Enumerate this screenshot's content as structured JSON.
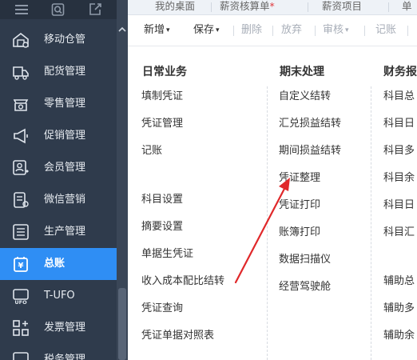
{
  "sidebar": {
    "top_icons": [
      "menu-icon",
      "search-icon",
      "export-icon"
    ],
    "items": [
      {
        "label": "移动仓管",
        "icon": "mobile-warehouse-icon"
      },
      {
        "label": "配货管理",
        "icon": "distribution-icon"
      },
      {
        "label": "零售管理",
        "icon": "retail-icon"
      },
      {
        "label": "促销管理",
        "icon": "megaphone-icon"
      },
      {
        "label": "会员管理",
        "icon": "member-icon"
      },
      {
        "label": "微信营销",
        "icon": "wechat-icon"
      },
      {
        "label": "生产管理",
        "icon": "production-icon"
      },
      {
        "label": "总账",
        "icon": "general-ledger-icon",
        "active": true
      },
      {
        "label": "T-UFO",
        "icon": "ufo-icon"
      },
      {
        "label": "发票管理",
        "icon": "invoice-icon"
      },
      {
        "label": "税务管理",
        "icon": "tax-icon"
      }
    ]
  },
  "tabs": [
    {
      "label": "我的桌面",
      "modified": ""
    },
    {
      "label": "薪资核算单",
      "modified": "*"
    },
    {
      "label": "薪资项目",
      "modified": ""
    },
    {
      "label": "单",
      "modified": ""
    }
  ],
  "toolbar": {
    "new_label": "新增",
    "save_label": "保存",
    "delete_label": "删除",
    "discard_label": "放弃",
    "audit_label": "审核",
    "post_label": "记账"
  },
  "columns": {
    "daily": {
      "title": "日常业务",
      "items": [
        "填制凭证",
        "凭证管理",
        "记账",
        "科目设置",
        "摘要设置",
        "单据生凭证",
        "收入成本配比结转",
        "凭证查询",
        "凭证单据对照表",
        "..."
      ]
    },
    "period_end": {
      "title": "期末处理",
      "items": [
        "自定义结转",
        "汇兑损益结转",
        "期间损益结转",
        "凭证整理",
        "凭证打印",
        "账簿打印",
        "数据扫描仪",
        "经营驾驶舱"
      ]
    },
    "reports": {
      "title": "财务报",
      "items": [
        "科目总",
        "科目日",
        "科目多",
        "科目余",
        "科目日",
        "科目汇",
        "辅助总",
        "辅助多",
        "辅助余"
      ]
    }
  },
  "colors": {
    "sidebar_bg": "#2f3b4c",
    "active_bg": "#2f8ef4",
    "annotation_arrow": "#e0282a"
  }
}
